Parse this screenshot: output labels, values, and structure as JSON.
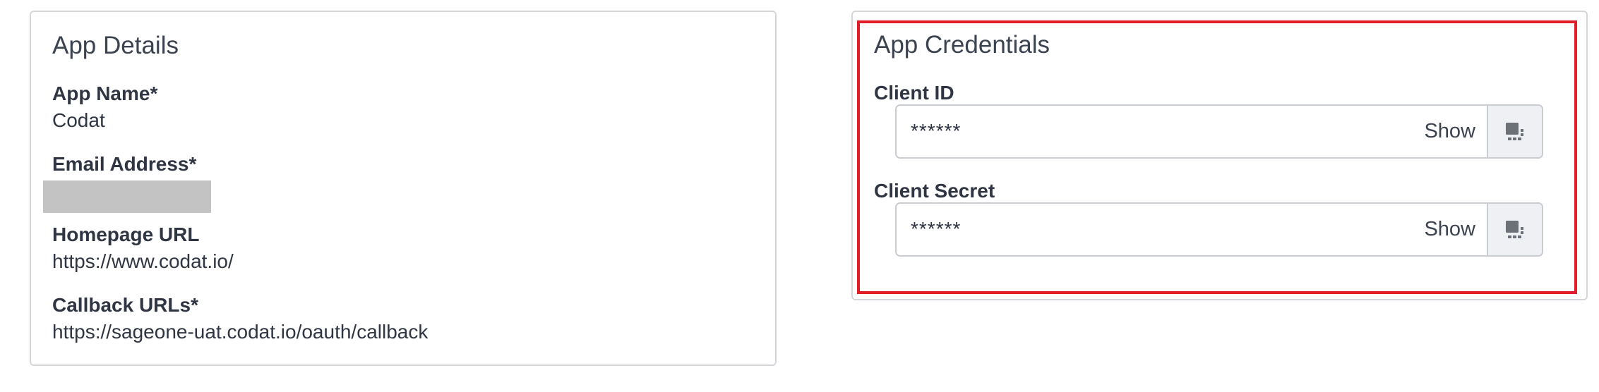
{
  "app_details": {
    "title": "App Details",
    "fields": [
      {
        "label": "App Name*",
        "value": "Codat"
      },
      {
        "label": "Email Address*",
        "value": ""
      },
      {
        "label": "Homepage URL",
        "value": "https://www.codat.io/"
      },
      {
        "label": "Callback URLs*",
        "value": "https://sageone-uat.codat.io/oauth/callback"
      }
    ]
  },
  "app_credentials": {
    "title": "App Credentials",
    "client_id": {
      "label": "Client ID",
      "masked_value": "******",
      "show_label": "Show",
      "copy_icon": "copy-to-clipboard-icon"
    },
    "client_secret": {
      "label": "Client Secret",
      "masked_value": "******",
      "show_label": "Show",
      "copy_icon": "copy-to-clipboard-icon"
    }
  },
  "colors": {
    "highlight_border": "#e11d2a",
    "redaction": "#c3c3c3",
    "panel_border": "#d4d6da",
    "copy_button_bg": "#eef0f3"
  }
}
